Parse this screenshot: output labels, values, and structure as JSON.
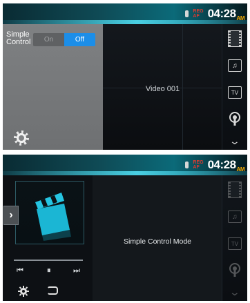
{
  "status": {
    "reg_line1": "REG",
    "reg_line2": "AF",
    "time": "04:28",
    "ampm": "AM"
  },
  "screen1": {
    "control_label_line1": "Simple",
    "control_label_line2": "Control",
    "toggle_on": "On",
    "toggle_off": "Off",
    "selected": "Off",
    "video_title": "Video 001"
  },
  "screen2": {
    "mode_label": "Simple Control Mode",
    "side_toggle": "›",
    "prev": "⏮",
    "pause": "⏸",
    "next": "⏭"
  },
  "sidebar": {
    "items": [
      {
        "name": "video-source-icon"
      },
      {
        "name": "music-source-icon",
        "glyph": "♫"
      },
      {
        "name": "tv-source-icon",
        "glyph": "TV"
      },
      {
        "name": "podcast-source-icon"
      },
      {
        "name": "more-chevron-icon",
        "glyph": "⌄"
      }
    ]
  },
  "colors": {
    "accent": "#1c8ee8",
    "panel_gray": "#7f8183",
    "status_teal": "#0b6a79",
    "media_icon": "#1bb6d4"
  }
}
